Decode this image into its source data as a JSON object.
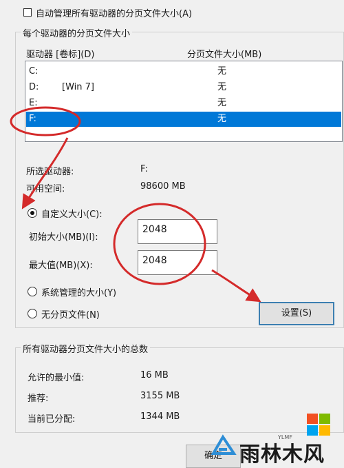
{
  "auto_manage": {
    "label": "自动管理所有驱动器的分页文件大小(A)",
    "checked": false
  },
  "per_drive_group": {
    "title": "每个驱动器的分页文件大小",
    "headers": {
      "drive": "驱动器 [卷标](D)",
      "size": "分页文件大小(MB)"
    },
    "drives": [
      {
        "letter": "C:",
        "label": "",
        "size": "无"
      },
      {
        "letter": "D:",
        "label": "[Win 7]",
        "size": "无"
      },
      {
        "letter": "E:",
        "label": "",
        "size": "无"
      },
      {
        "letter": "F:",
        "label": "",
        "size": "无",
        "selected": true
      }
    ]
  },
  "selected_info": {
    "drive_label": "所选驱动器:",
    "drive_value": "F:",
    "space_label": "可用空间:",
    "space_value": "98600 MB"
  },
  "size_options": {
    "custom_label": "自定义大小(C):",
    "initial_label": "初始大小(MB)(I):",
    "initial_value": "2048",
    "max_label": "最大值(MB)(X):",
    "max_value": "2048",
    "system_label": "系统管理的大小(Y)",
    "none_label": "无分页文件(N)",
    "selected": "custom"
  },
  "set_button": "设置(S)",
  "totals_group": {
    "title": "所有驱动器分页文件大小的总数",
    "rows": [
      {
        "label": "允许的最小值:",
        "value": "16 MB"
      },
      {
        "label": "推荐:",
        "value": "3155 MB"
      },
      {
        "label": "当前已分配:",
        "value": "1344 MB"
      }
    ]
  },
  "ok_button": "确定",
  "watermark": {
    "text": "雨林木风",
    "sub": "YLMF"
  },
  "annotation_color": "#d42a2a"
}
